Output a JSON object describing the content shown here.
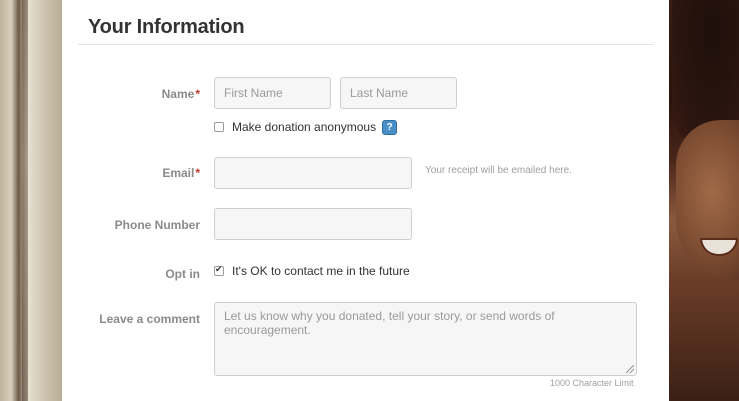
{
  "form": {
    "title": "Your Information",
    "name": {
      "label": "Name",
      "required_marker": "*",
      "first_placeholder": "First Name",
      "last_placeholder": "Last Name"
    },
    "anonymous": {
      "label": "Make donation anonymous",
      "checked": false,
      "help_icon": "?"
    },
    "email": {
      "label": "Email",
      "required_marker": "*",
      "value": "",
      "hint": "Your receipt will be emailed here."
    },
    "phone": {
      "label": "Phone Number",
      "value": ""
    },
    "opt_in": {
      "label": "Opt in",
      "checkbox_label": "It's OK to contact me in the future",
      "checked": true
    },
    "comment": {
      "label": "Leave a comment",
      "placeholder": "Let us know why you donated, tell your story, or send words of encouragement.",
      "limit_text": "1000 Character Limit"
    }
  },
  "colors": {
    "required": "#c0392b",
    "help_icon": "#4a90c8",
    "label": "#8a8a8a"
  }
}
